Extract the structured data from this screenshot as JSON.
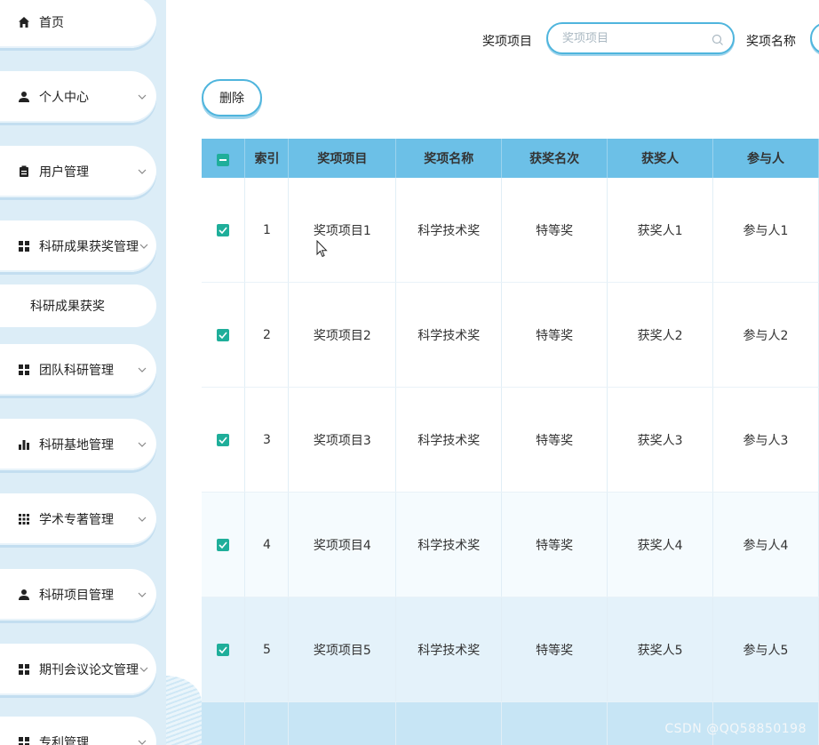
{
  "sidebar": {
    "items": [
      {
        "label": "首页",
        "icon": "home-icon",
        "expandable": false
      },
      {
        "label": "个人中心",
        "icon": "person-icon",
        "expandable": true
      },
      {
        "label": "用户管理",
        "icon": "clipboard-icon",
        "expandable": true
      },
      {
        "label": "科研成果获奖管理",
        "icon": "grid-icon",
        "expandable": true
      },
      {
        "label": "团队科研管理",
        "icon": "grid-icon",
        "expandable": true
      },
      {
        "label": "科研基地管理",
        "icon": "bar-chart-icon",
        "expandable": true
      },
      {
        "label": "学术专著管理",
        "icon": "apps-icon",
        "expandable": true
      },
      {
        "label": "科研项目管理",
        "icon": "person-icon",
        "expandable": true
      },
      {
        "label": "期刊会议论文管理",
        "icon": "grid-icon",
        "expandable": true
      },
      {
        "label": "专利管理",
        "icon": "grid-icon",
        "expandable": true
      }
    ],
    "sub_item": "科研成果获奖"
  },
  "search": {
    "field1_label": "奖项项目",
    "field1_placeholder": "奖项项目",
    "field2_label": "奖项名称"
  },
  "toolbar": {
    "delete_label": "删除"
  },
  "table": {
    "columns": [
      "索引",
      "奖项项目",
      "奖项名称",
      "获奖名次",
      "获奖人",
      "参与人"
    ],
    "rows": [
      {
        "index": "1",
        "project": "奖项项目1",
        "name": "科学技术奖",
        "rank": "特等奖",
        "winner": "获奖人1",
        "participant": "参与人1",
        "checked": true
      },
      {
        "index": "2",
        "project": "奖项项目2",
        "name": "科学技术奖",
        "rank": "特等奖",
        "winner": "获奖人2",
        "participant": "参与人2",
        "checked": true
      },
      {
        "index": "3",
        "project": "奖项项目3",
        "name": "科学技术奖",
        "rank": "特等奖",
        "winner": "获奖人3",
        "participant": "参与人3",
        "checked": true
      },
      {
        "index": "4",
        "project": "奖项项目4",
        "name": "科学技术奖",
        "rank": "特等奖",
        "winner": "获奖人4",
        "participant": "参与人4",
        "checked": true
      },
      {
        "index": "5",
        "project": "奖项项目5",
        "name": "科学技术奖",
        "rank": "特等奖",
        "winner": "获奖人5",
        "participant": "参与人5",
        "checked": true
      }
    ]
  },
  "watermark": "CSDN @QQ58850198",
  "colors": {
    "accent": "#4fb5dd",
    "header": "#6cc0e7",
    "checkbox": "#1fae9a",
    "sidebar_bg": "#dcedf7"
  }
}
